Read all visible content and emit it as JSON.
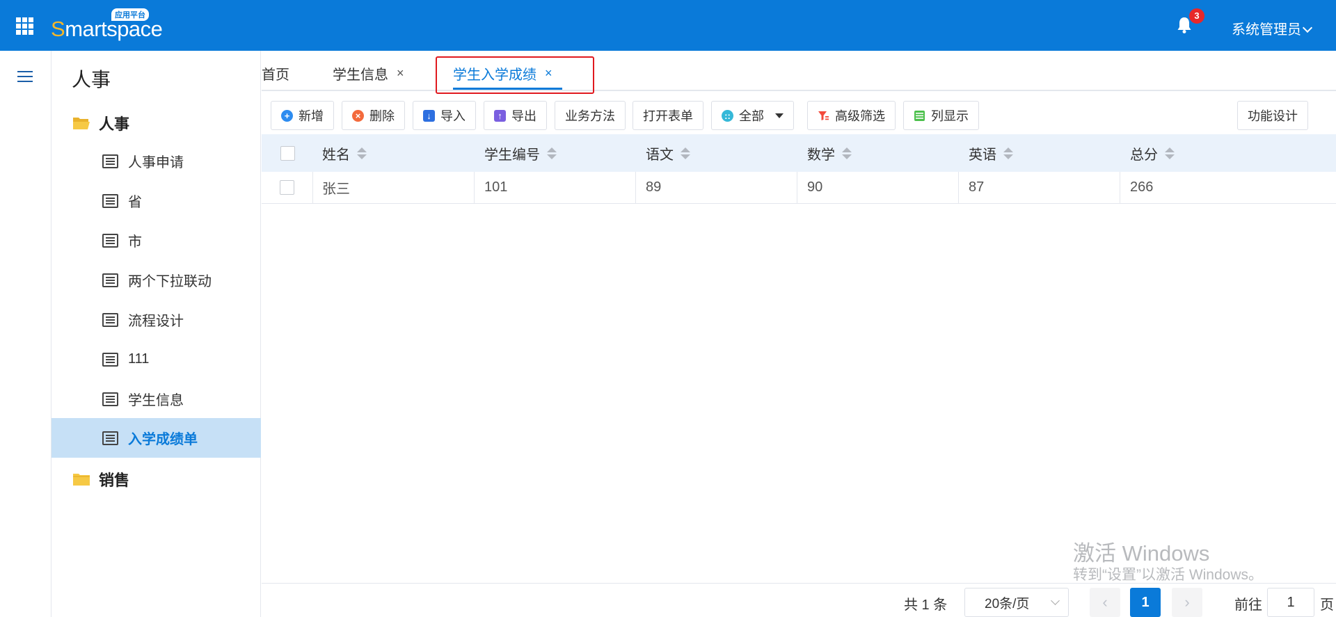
{
  "header": {
    "logo_first": "S",
    "logo_rest": "martspace",
    "logo_badge": "应用平台",
    "notification_count": "3",
    "user_name": "系统管理员"
  },
  "sidebar": {
    "title": "人事",
    "groups": [
      {
        "label": "人事"
      },
      {
        "label": "销售"
      }
    ],
    "items": [
      {
        "label": "人事申请"
      },
      {
        "label": "省"
      },
      {
        "label": "市"
      },
      {
        "label": "两个下拉联动"
      },
      {
        "label": "流程设计"
      },
      {
        "label": "111"
      },
      {
        "label": "学生信息"
      },
      {
        "label": "入学成绩单"
      }
    ],
    "active_item": "入学成绩单"
  },
  "tabs": [
    {
      "label": "首页",
      "closable": false
    },
    {
      "label": "学生信息",
      "closable": true,
      "close": "×"
    },
    {
      "label": "学生入学成绩",
      "closable": true,
      "close": "×"
    }
  ],
  "active_tab": "学生入学成绩",
  "toolbar": {
    "add": "新增",
    "delete": "删除",
    "import": "导入",
    "export": "导出",
    "business_method": "业务方法",
    "open_form": "打开表单",
    "scope": "全部",
    "advanced_filter": "高级筛选",
    "column_display": "列显示",
    "function_design": "功能设计"
  },
  "table": {
    "columns": [
      "姓名",
      "学生编号",
      "语文",
      "数学",
      "英语",
      "总分"
    ],
    "rows": [
      [
        "张三",
        "101",
        "89",
        "90",
        "87",
        "266"
      ]
    ]
  },
  "watermark": {
    "line1": "激活 Windows",
    "line2": "转到“设置”以激活 Windows。"
  },
  "pagination": {
    "total": "共 1 条",
    "page_size": "20条/页",
    "current_page": "1",
    "goto_label": "前往",
    "goto_value": "1",
    "page_suffix": "页"
  },
  "colors": {
    "brand": "#0a7ad9",
    "highlight_border": "#e0191f",
    "active_sidebar_bg": "#c6e0f6",
    "badge": "#e7282a"
  }
}
